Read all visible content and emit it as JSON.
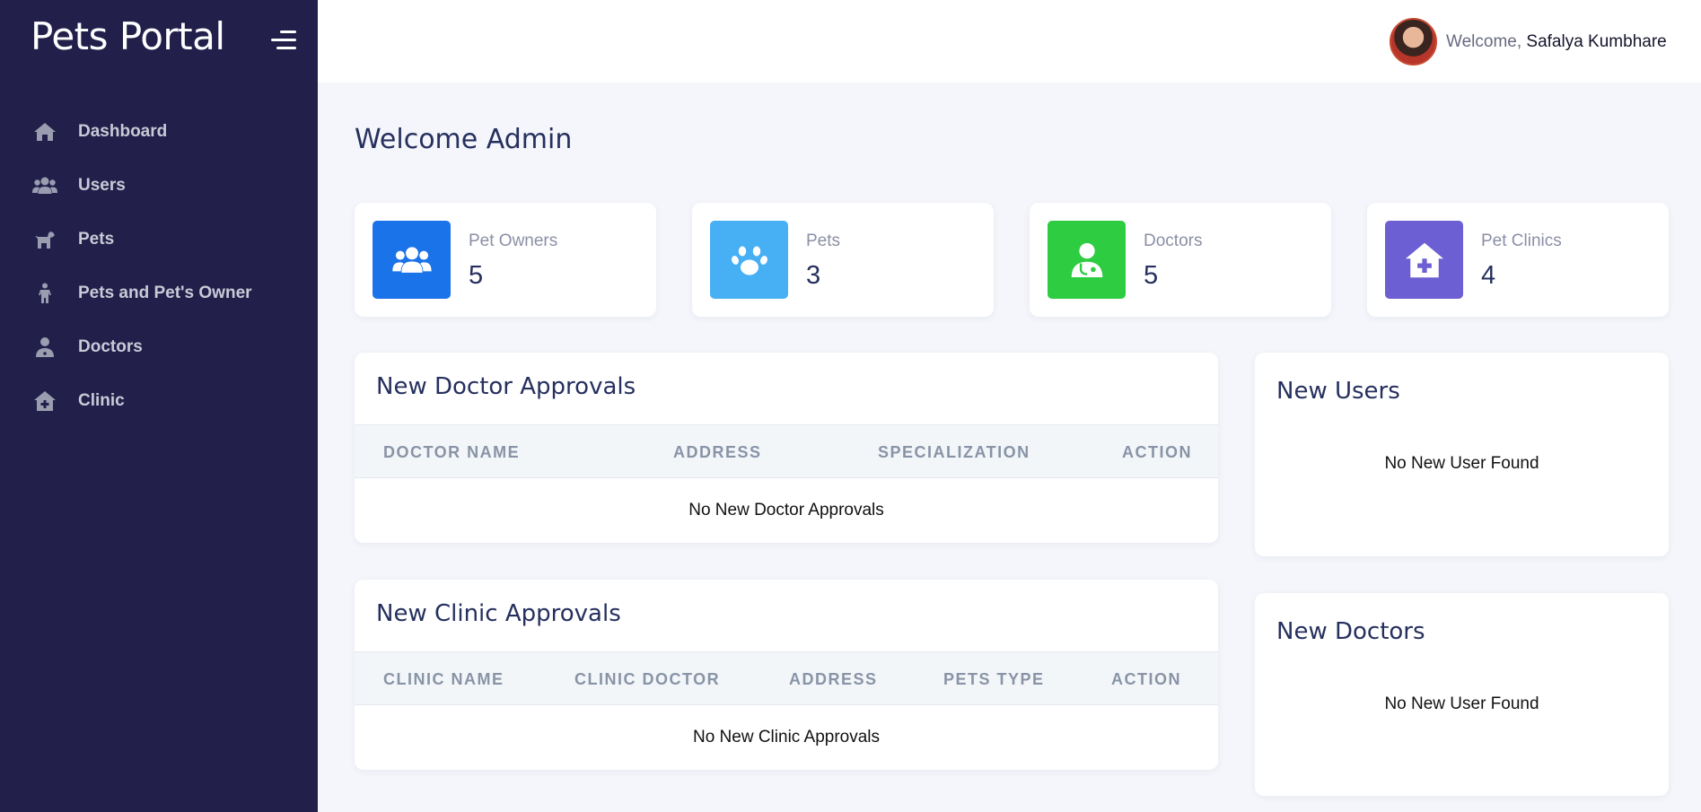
{
  "sidebar": {
    "brand": "Pets Portal",
    "items": [
      {
        "label": "Dashboard",
        "icon": "home-icon"
      },
      {
        "label": "Users",
        "icon": "users-icon"
      },
      {
        "label": "Pets",
        "icon": "dog-icon"
      },
      {
        "label": "Pets and Pet's Owner",
        "icon": "child-icon"
      },
      {
        "label": "Doctors",
        "icon": "doctor-icon"
      },
      {
        "label": "Clinic",
        "icon": "clinic-icon"
      }
    ]
  },
  "header": {
    "welcome_prefix": "Welcome,",
    "user_name": "Safalya Kumbhare"
  },
  "main": {
    "title": "Welcome Admin",
    "stats": [
      {
        "label": "Pet Owners",
        "value": "5",
        "color": "#1a73e8",
        "icon": "users-icon"
      },
      {
        "label": "Pets",
        "value": "3",
        "color": "#47b0f5",
        "icon": "paw-icon"
      },
      {
        "label": "Doctors",
        "value": "5",
        "color": "#2ecc40",
        "icon": "doctor-icon"
      },
      {
        "label": "Pet Clinics",
        "value": "4",
        "color": "#6c5fd3",
        "icon": "clinic-icon"
      }
    ],
    "doctor_approvals": {
      "title": "New Doctor Approvals",
      "columns": [
        "DOCTOR NAME",
        "ADDRESS",
        "SPECIALIZATION",
        "ACTION"
      ],
      "empty": "No New Doctor Approvals"
    },
    "clinic_approvals": {
      "title": "New Clinic Approvals",
      "columns": [
        "CLINIC NAME",
        "CLINIC DOCTOR",
        "ADDRESS",
        "PETS TYPE",
        "ACTION"
      ],
      "empty": "No New Clinic Approvals"
    },
    "new_users": {
      "title": "New Users",
      "empty": "No New User Found"
    },
    "new_doctors": {
      "title": "New Doctors",
      "empty": "No New User Found"
    }
  }
}
